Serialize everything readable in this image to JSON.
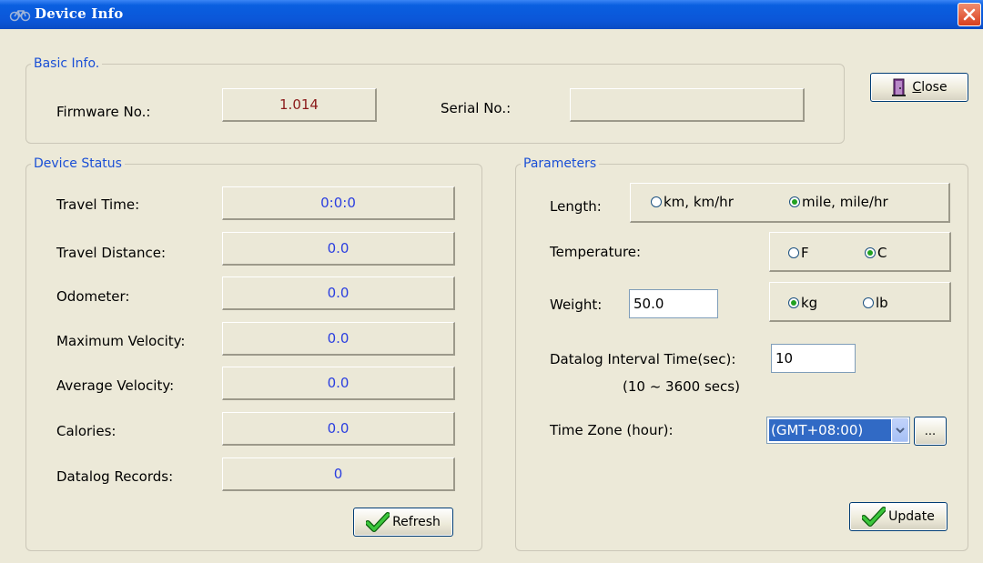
{
  "window": {
    "title": "Device Info"
  },
  "close_button": {
    "label_u": "C",
    "label_rest": "lose"
  },
  "basic_info": {
    "legend": "Basic Info.",
    "firmware_label": "Firmware No.:",
    "firmware_value": "1.014",
    "serial_label": "Serial No.:",
    "serial_value": ""
  },
  "device_status": {
    "legend": "Device Status",
    "rows": [
      {
        "label": "Travel Time:",
        "value": "0:0:0"
      },
      {
        "label": "Travel Distance:",
        "value": "0.0"
      },
      {
        "label": "Odometer:",
        "value": "0.0"
      },
      {
        "label": "Maximum Velocity:",
        "value": "0.0"
      },
      {
        "label": "Average Velocity:",
        "value": "0.0"
      },
      {
        "label": "Calories:",
        "value": "0.0"
      },
      {
        "label": "Datalog Records:",
        "value": "0"
      }
    ],
    "refresh_label": "Refresh"
  },
  "parameters": {
    "legend": "Parameters",
    "length_label": "Length:",
    "length_options": [
      "km, km/hr",
      "mile, mile/hr"
    ],
    "length_selected": "mile, mile/hr",
    "temperature_label": "Temperature:",
    "temperature_options": [
      "F",
      "C"
    ],
    "temperature_selected": "C",
    "weight_label": "Weight:",
    "weight_value": "50.0",
    "weight_options": [
      "kg",
      "lb"
    ],
    "weight_selected": "kg",
    "datalog_label": "Datalog Interval Time(sec):",
    "datalog_value": "10",
    "datalog_range": "(10 ~ 3600 secs)",
    "timezone_label": "Time Zone (hour):",
    "timezone_value": "(GMT+08:00)",
    "timezone_more": "...",
    "update_label": "Update"
  }
}
